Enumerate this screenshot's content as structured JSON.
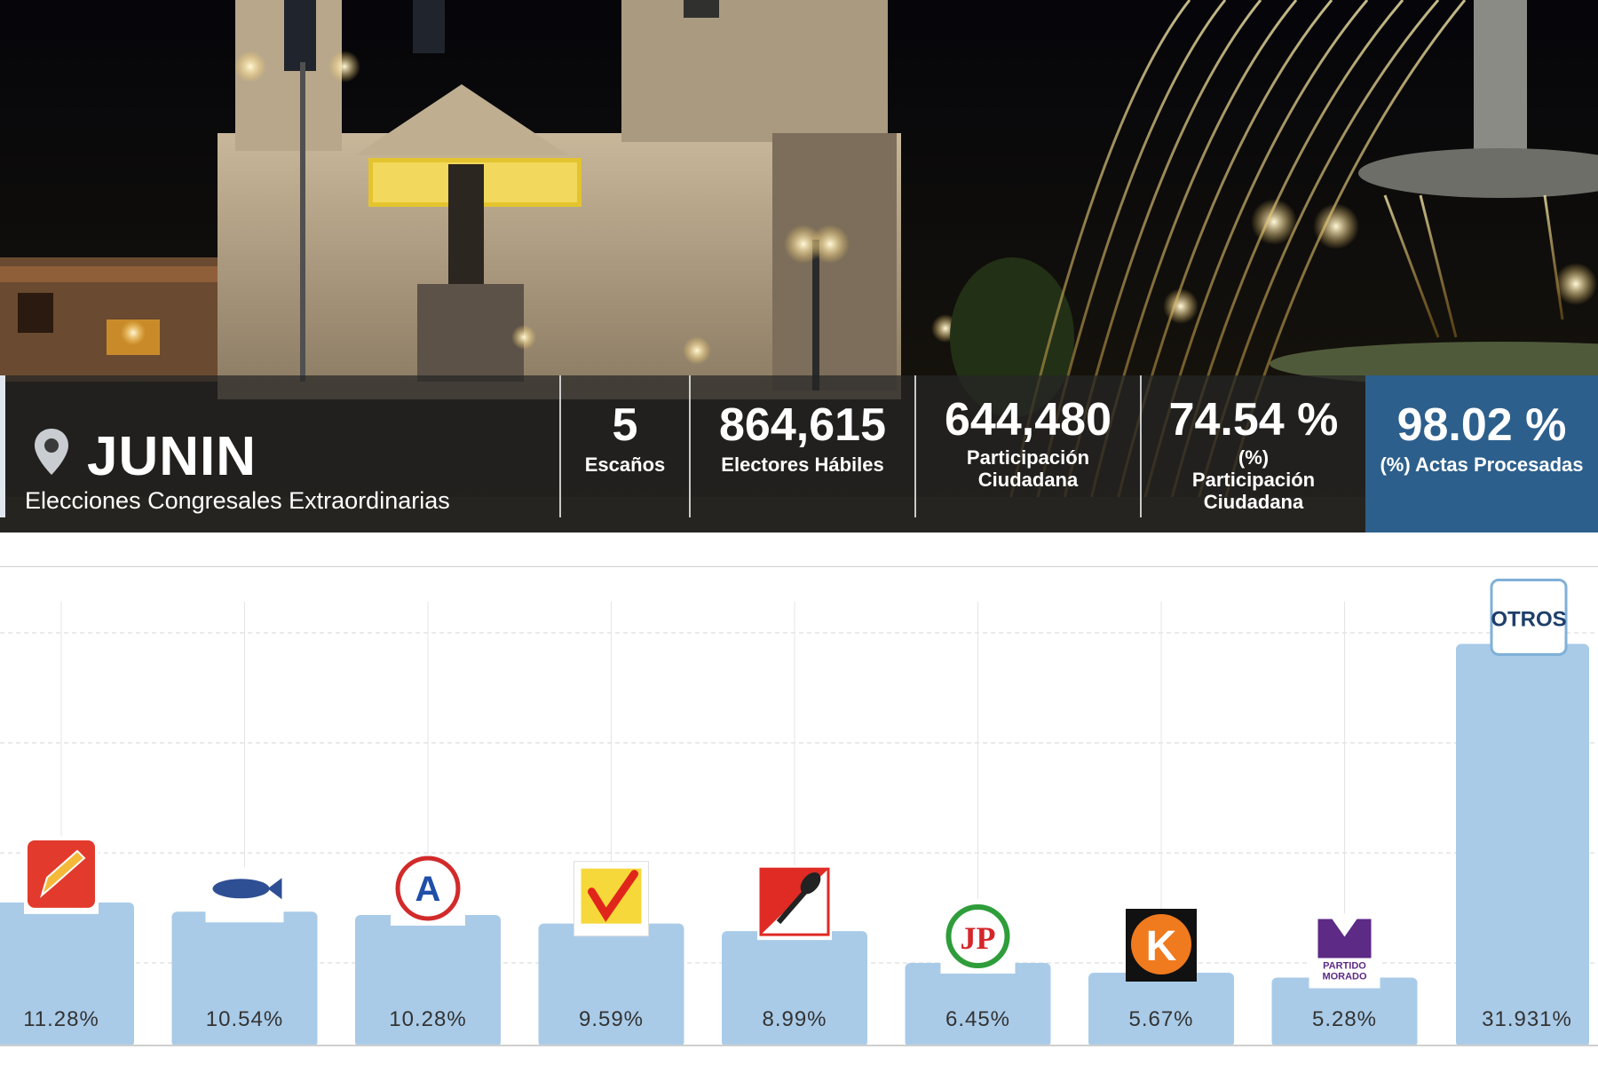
{
  "header": {
    "region": "JUNIN",
    "subtitle": "Elecciones Congresales Extraordinarias",
    "stats": [
      {
        "value": "5",
        "label": "Escaños"
      },
      {
        "value": "864,615",
        "label": "Electores Hábiles"
      },
      {
        "value": "644,480",
        "label": "Participación Ciudadana"
      },
      {
        "value": "74.54 %",
        "label": "(%) Participación Ciudadana"
      },
      {
        "value": "98.02 %",
        "label": "(%) Actas Procesadas"
      }
    ],
    "highlight_color": "#2d5f8c"
  },
  "chart_data": {
    "type": "bar",
    "categories": [
      "lapiz",
      "pez",
      "A",
      "check",
      "pala",
      "JP",
      "K",
      "PARTIDO MORADO",
      "OTROS"
    ],
    "values": [
      11.28,
      10.54,
      10.28,
      9.59,
      8.99,
      6.45,
      5.67,
      5.28,
      31.931
    ],
    "value_labels": [
      "11.28%",
      "10.54%",
      "10.28%",
      "9.59%",
      "8.99%",
      "6.45%",
      "5.67%",
      "5.28%",
      "31.931%"
    ],
    "ylim": [
      0,
      36
    ],
    "grid": true,
    "bar_color": "#a9cbe8",
    "logos": [
      "pencil-logo",
      "fish-logo",
      "letter-a-logo",
      "check-logo",
      "shovel-logo",
      "jp-logo",
      "k-logo",
      "partido-morado-logo",
      "otros-logo"
    ],
    "logo_texts": {
      "jp": "JP",
      "k": "K",
      "morado_word": "PARTIDO",
      "morado_word2": "MORADO",
      "otros": "OTROS",
      "a": "A"
    }
  }
}
